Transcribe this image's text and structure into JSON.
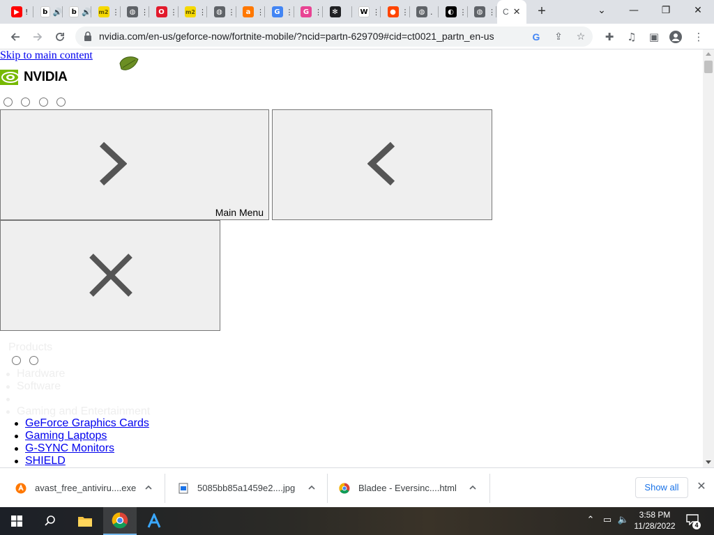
{
  "browser": {
    "tabs": [
      {
        "icon": "youtube-icon",
        "color": "#ff0000",
        "glyph": "▶",
        "extra": "!"
      },
      {
        "icon": "bandcamp-icon",
        "color": "#ffffff",
        "glyph": "b",
        "extra": "🔊"
      },
      {
        "icon": "bandcamp-icon",
        "color": "#ffffff",
        "glyph": "b",
        "extra": "🔊"
      },
      {
        "icon": "m2-icon",
        "color": "#f5d800",
        "glyph": "m2",
        "extra": "⋮"
      },
      {
        "icon": "globe-icon",
        "color": "#5f6368",
        "glyph": "◍",
        "extra": "⋮"
      },
      {
        "icon": "opera-icon",
        "color": "#e21a2c",
        "glyph": "O",
        "extra": "⋮"
      },
      {
        "icon": "m2-icon",
        "color": "#f5d800",
        "glyph": "m2",
        "extra": "⋮"
      },
      {
        "icon": "globe-icon",
        "color": "#5f6368",
        "glyph": "◍",
        "extra": "⋮"
      },
      {
        "icon": "avast-icon",
        "color": "#ff7800",
        "glyph": "a",
        "extra": "⋮"
      },
      {
        "icon": "google-icon",
        "color": "#4285f4",
        "glyph": "G",
        "extra": "⋮"
      },
      {
        "icon": "gp-icon",
        "color": "#e84393",
        "glyph": "G",
        "extra": "⋮"
      },
      {
        "icon": "chatgpt-icon",
        "color": "#202124",
        "glyph": "✻",
        "extra": ""
      },
      {
        "icon": "wikipedia-icon",
        "color": "#ffffff",
        "glyph": "W",
        "extra": "⋮"
      },
      {
        "icon": "reddit-icon",
        "color": "#ff4500",
        "glyph": "●",
        "extra": "⋮"
      },
      {
        "icon": "globe-icon",
        "color": "#5f6368",
        "glyph": "◍",
        "extra": "."
      },
      {
        "icon": "moon-icon",
        "color": "#000000",
        "glyph": "◐",
        "extra": "⋮"
      },
      {
        "icon": "globe-icon",
        "color": "#5f6368",
        "glyph": "◍",
        "extra": "⋮"
      }
    ],
    "active_tab": {
      "icon": "loading-icon",
      "glyph": "C",
      "close": "✕"
    },
    "new_tab": "+",
    "window_controls": {
      "chevron": "⌄",
      "minimize": "—",
      "restore": "❐",
      "close": "✕"
    },
    "url": "nvidia.com/en-us/geforce-now/fortnite-mobile/?ncid=partn-629709#cid=ct0021_partn_en-us"
  },
  "page": {
    "skip_link": "Skip to main content",
    "logo_text": "NVIDIA",
    "panel_label": "Main Menu",
    "products_heading": "Products",
    "faded_items": [
      "Hardware",
      "Software",
      "Gaming and Entertainment"
    ],
    "links": [
      "GeForce Graphics Cards",
      "Gaming Laptops",
      "G-SYNC Monitors",
      "SHIELD"
    ]
  },
  "downloads": {
    "items": [
      {
        "name": "avast_free_antiviru....exe",
        "icon": "avast-icon"
      },
      {
        "name": "5085bb85a1459e2....jpg",
        "icon": "image-file-icon"
      },
      {
        "name": "Bladee - Eversinc....html",
        "icon": "chrome-icon"
      }
    ],
    "show_all": "Show all",
    "close": "✕"
  },
  "taskbar": {
    "time": "3:58 PM",
    "date": "11/28/2022",
    "notification_count": "4",
    "accent": "#76b9ed"
  }
}
